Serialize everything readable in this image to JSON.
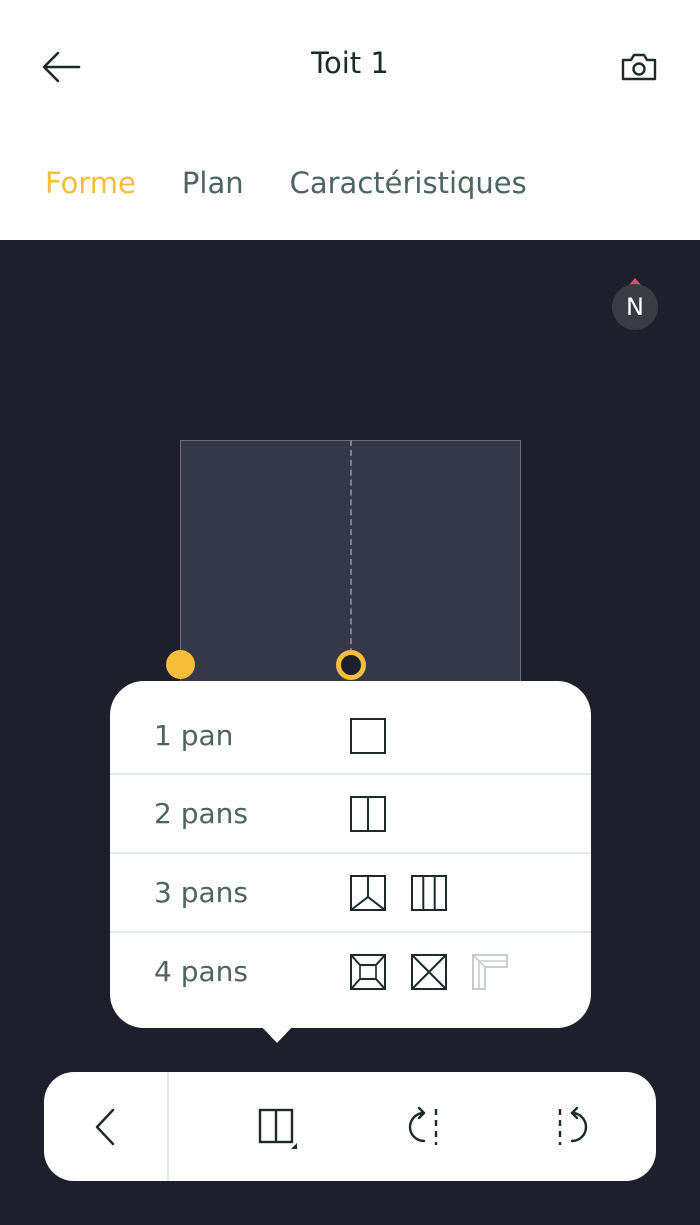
{
  "header": {
    "title": "Toit 1",
    "back_icon": "arrow-left-icon",
    "camera_icon": "camera-icon"
  },
  "tabs": [
    {
      "label": "Forme",
      "active": true
    },
    {
      "label": "Plan",
      "active": false
    },
    {
      "label": "Caractéristiques",
      "active": false
    }
  ],
  "canvas": {
    "compass_label": "N"
  },
  "shape_menu": {
    "rows": [
      {
        "label": "1 pan",
        "options": [
          "single-slope-icon"
        ]
      },
      {
        "label": "2 pans",
        "options": [
          "gable-roof-icon"
        ]
      },
      {
        "label": "3 pans",
        "options": [
          "hip-triangle-roof-icon",
          "three-slope-strip-icon"
        ]
      },
      {
        "label": "4 pans",
        "options": [
          "hip-roof-icon",
          "pyramid-roof-icon",
          "l-shaped-roof-icon"
        ]
      }
    ],
    "disabled_option": "l-shaped-roof-icon"
  },
  "toolbar": {
    "items": [
      "chevron-left-icon",
      "roof-shape-icon",
      "rotate-cw-icon",
      "rotate-ccw-icon"
    ]
  },
  "colors": {
    "accent": "#f4bd3a",
    "canvas_bg": "#1e1e2c",
    "roof_fill": "#353848",
    "text_dark": "#1c2a2a",
    "text_muted": "#4d6462",
    "compass_tip": "#e8476c"
  }
}
